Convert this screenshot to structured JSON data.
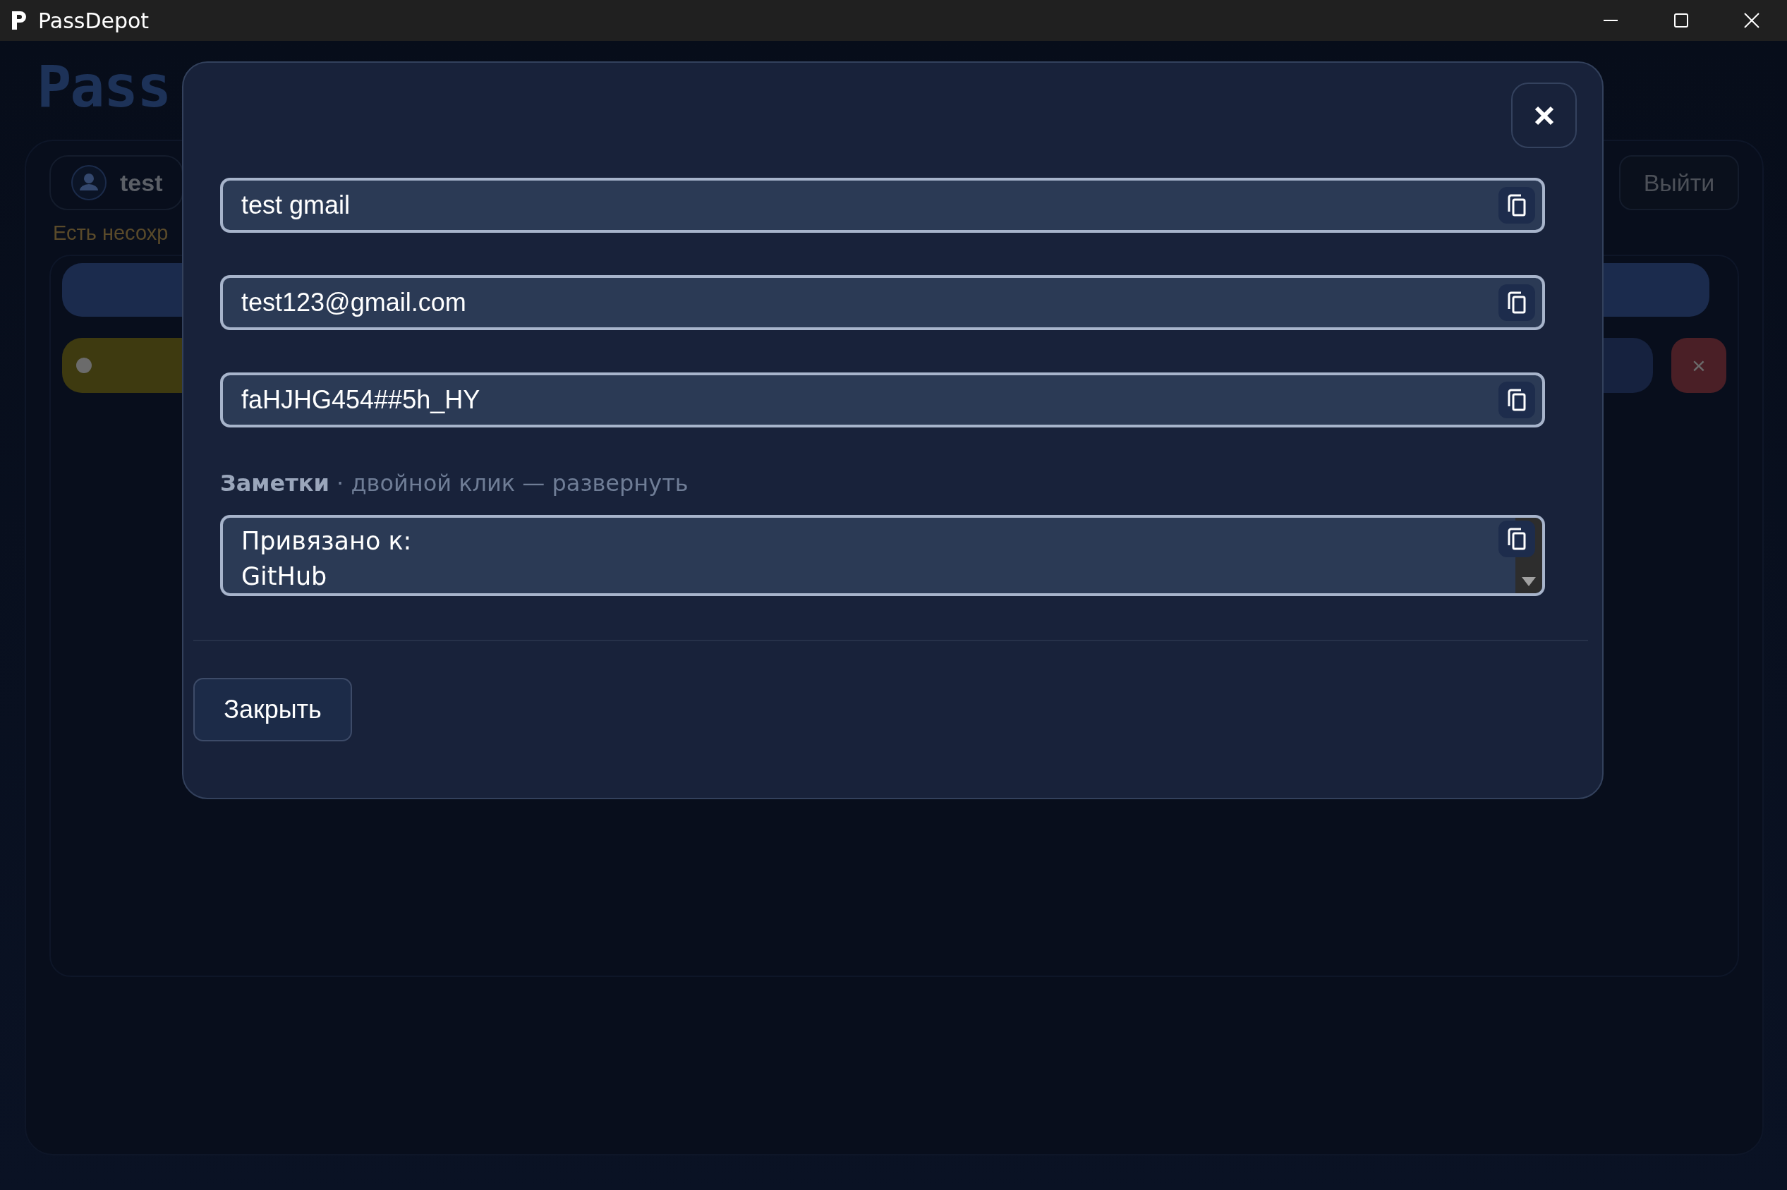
{
  "window": {
    "title": "PassDepot"
  },
  "app": {
    "logo": "Pass",
    "user": "test",
    "logout": "Выйти",
    "notice": "Есть несохр",
    "delete_icon": "×"
  },
  "dialog": {
    "fields": [
      {
        "value": "test gmail"
      },
      {
        "value": "test123@gmail.com"
      },
      {
        "value": "faHJHG454##5h_HY"
      }
    ],
    "notes": {
      "label": "**Заметки** · двойной клик — развернуть",
      "lines": [
        "Привязано к:",
        "GitHub"
      ]
    },
    "close_button": "Закрыть"
  }
}
